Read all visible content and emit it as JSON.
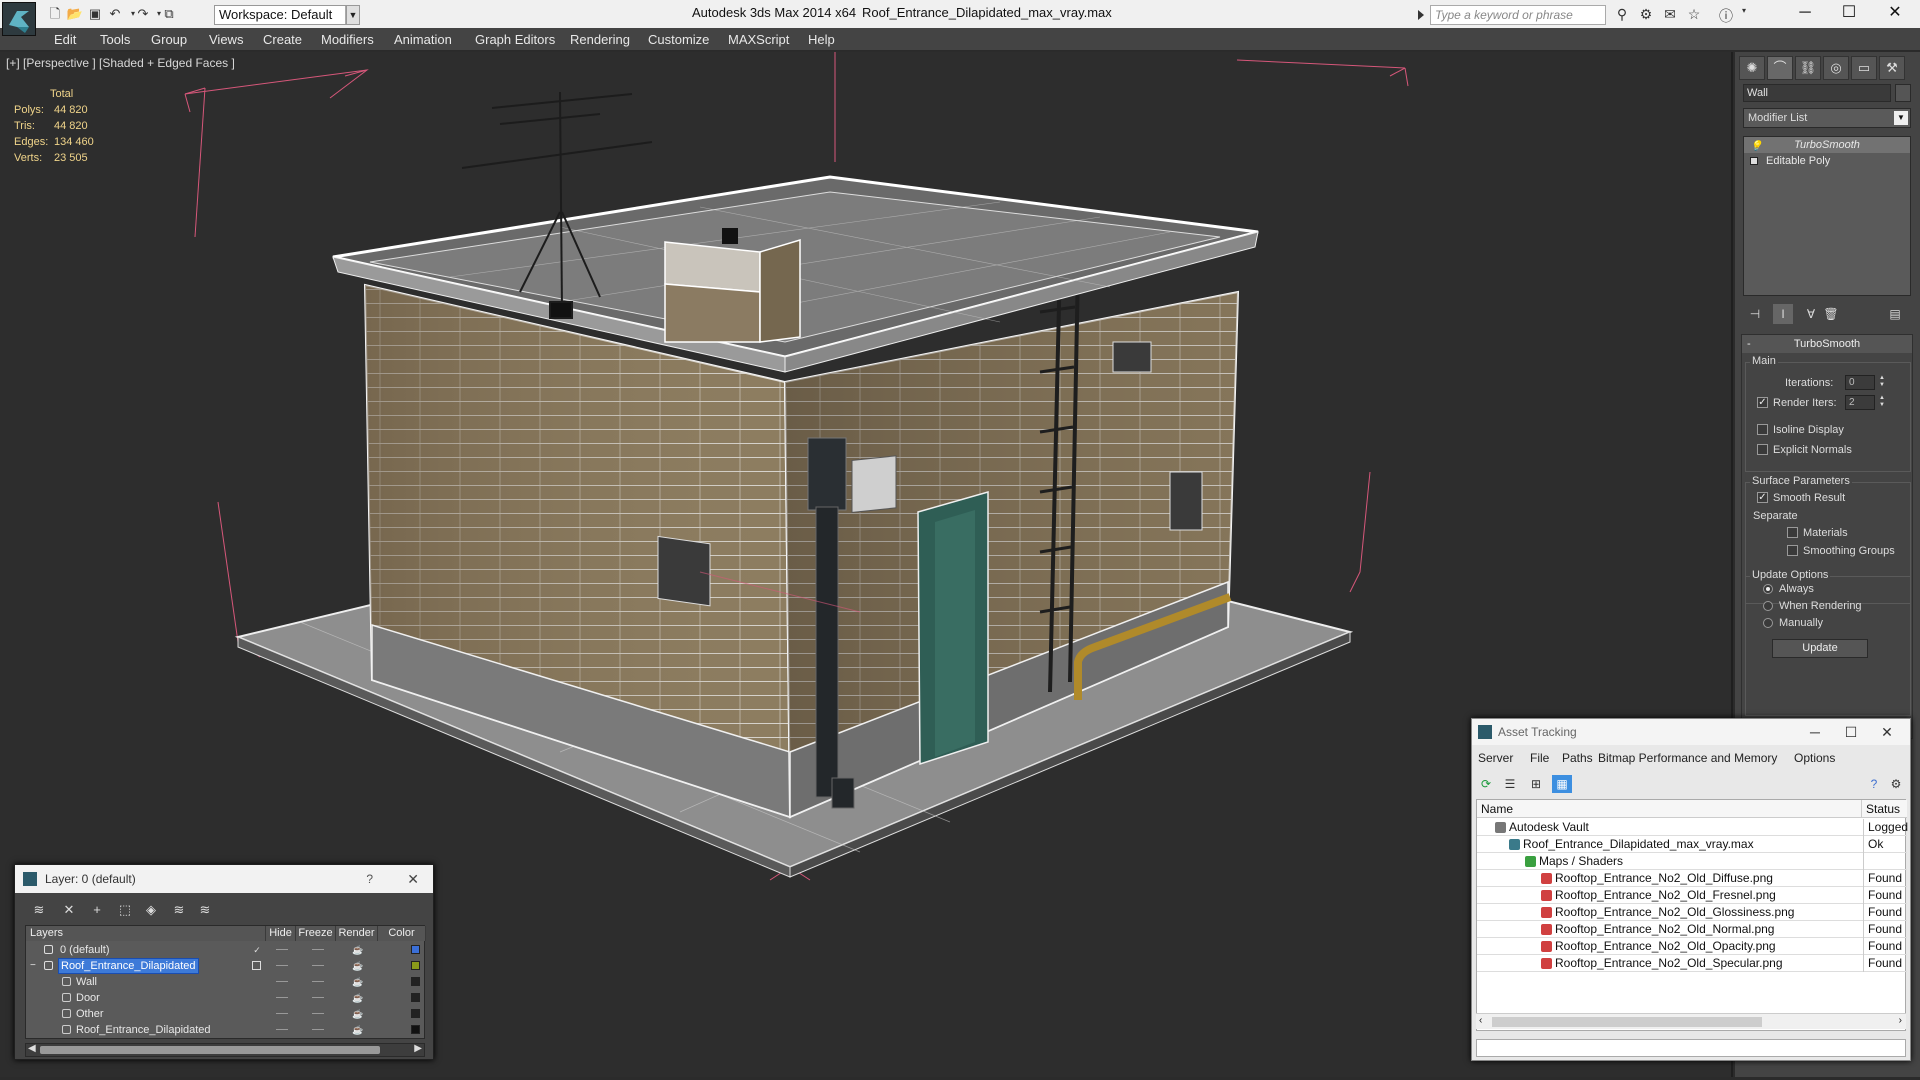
{
  "titlebar": {
    "workspace": "Workspace: Default",
    "app_title": "Autodesk 3ds Max  2014 x64",
    "file_title": "Roof_Entrance_Dilapidated_max_vray.max",
    "search_placeholder": "Type a keyword or phrase",
    "win_minimize": "─",
    "win_maximize": "☐",
    "win_close": "✕"
  },
  "menu": [
    "Edit",
    "Tools",
    "Group",
    "Views",
    "Create",
    "Modifiers",
    "Animation",
    "Graph Editors",
    "Rendering",
    "Customize",
    "MAXScript",
    "Help"
  ],
  "viewport": {
    "label": "[+] [Perspective ] [Shaded + Edged Faces ]",
    "stats": {
      "header": "Total",
      "polys_label": "Polys:",
      "polys": "44 820",
      "tris_label": "Tris:",
      "tris": "44 820",
      "edges_label": "Edges:",
      "edges": "134 460",
      "verts_label": "Verts:",
      "verts": "23 505"
    }
  },
  "command_panel": {
    "object_name": "Wall",
    "modifier_list": "Modifier List",
    "stack": [
      "TurboSmooth",
      "Editable Poly"
    ],
    "rollout_title": "TurboSmooth",
    "main_group": "Main",
    "iterations_label": "Iterations:",
    "iterations_value": "0",
    "render_iters_label": "Render Iters:",
    "render_iters_value": "2",
    "isoline_label": "Isoline Display",
    "explicit_normals_label": "Explicit Normals",
    "surface_group": "Surface Parameters",
    "smooth_result_label": "Smooth Result",
    "separate_label": "Separate",
    "materials_label": "Materials",
    "smoothing_groups_label": "Smoothing Groups",
    "update_group": "Update Options",
    "always_label": "Always",
    "when_rendering_label": "When Rendering",
    "manually_label": "Manually",
    "update_button": "Update"
  },
  "layer_dialog": {
    "title": "Layer: 0 (default)",
    "help": "?",
    "close": "✕",
    "columns": [
      "Layers",
      "Hide",
      "Freeze",
      "Render",
      "Color"
    ],
    "rows": [
      {
        "name": "0 (default)",
        "color": "#3b6fd6"
      },
      {
        "name": "Roof_Entrance_Dilapidated",
        "color": "#8a9a1a"
      },
      {
        "name": "Wall",
        "color": "#222222"
      },
      {
        "name": "Door",
        "color": "#222222"
      },
      {
        "name": "Other",
        "color": "#222222"
      },
      {
        "name": "Roof_Entrance_Dilapidated",
        "color": "#111111"
      }
    ]
  },
  "asset_dialog": {
    "title": "Asset Tracking",
    "menu": [
      "Server",
      "File",
      "Paths",
      "Bitmap Performance and Memory",
      "Options"
    ],
    "col_name": "Name",
    "col_status": "Status",
    "rows": [
      {
        "name": "Autodesk Vault",
        "status": "Logged"
      },
      {
        "name": "Roof_Entrance_Dilapidated_max_vray.max",
        "status": "Ok"
      },
      {
        "name": "Maps / Shaders",
        "status": ""
      },
      {
        "name": "Rooftop_Entrance_No2_Old_Diffuse.png",
        "status": "Found"
      },
      {
        "name": "Rooftop_Entrance_No2_Old_Fresnel.png",
        "status": "Found"
      },
      {
        "name": "Rooftop_Entrance_No2_Old_Glossiness.png",
        "status": "Found"
      },
      {
        "name": "Rooftop_Entrance_No2_Old_Normal.png",
        "status": "Found"
      },
      {
        "name": "Rooftop_Entrance_No2_Old_Opacity.png",
        "status": "Found"
      },
      {
        "name": "Rooftop_Entrance_No2_Old_Specular.png",
        "status": "Found"
      }
    ]
  },
  "colors": {
    "accent_blue": "#3d7ad8",
    "stats_yellow": "#f0d48a",
    "bbox_pink": "#d6577a"
  }
}
